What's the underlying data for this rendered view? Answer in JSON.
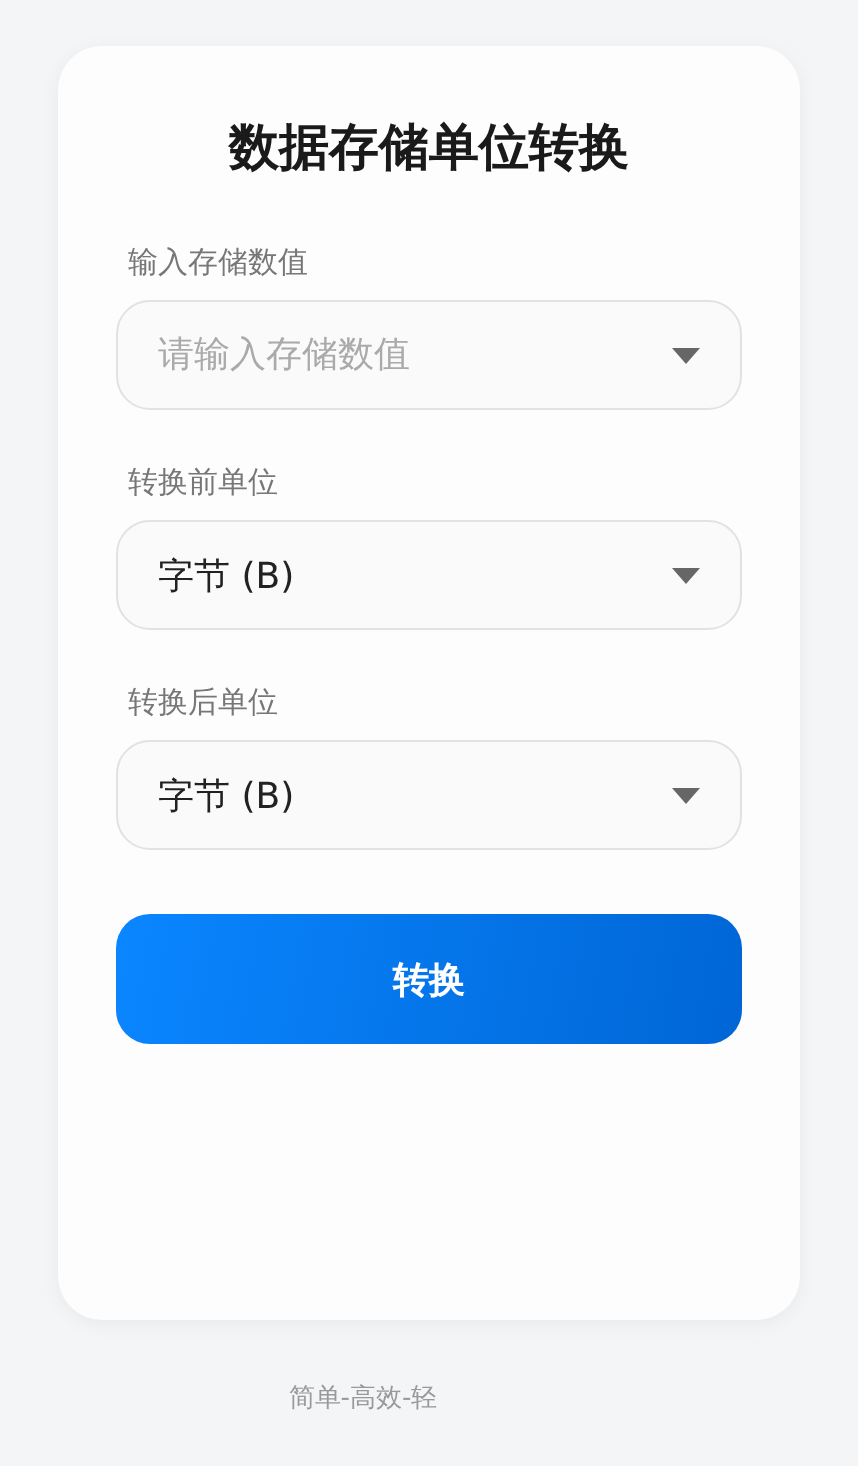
{
  "title": "数据存储单位转换",
  "fields": [
    {
      "label": "输入存储数值",
      "placeholder": "请输入存储数值"
    },
    {
      "label": "转换前单位",
      "value": "字节 (B)"
    },
    {
      "label": "转换后单位",
      "value": "字节 (B)"
    }
  ],
  "button": "转换",
  "footer": "简单-高效-轻"
}
